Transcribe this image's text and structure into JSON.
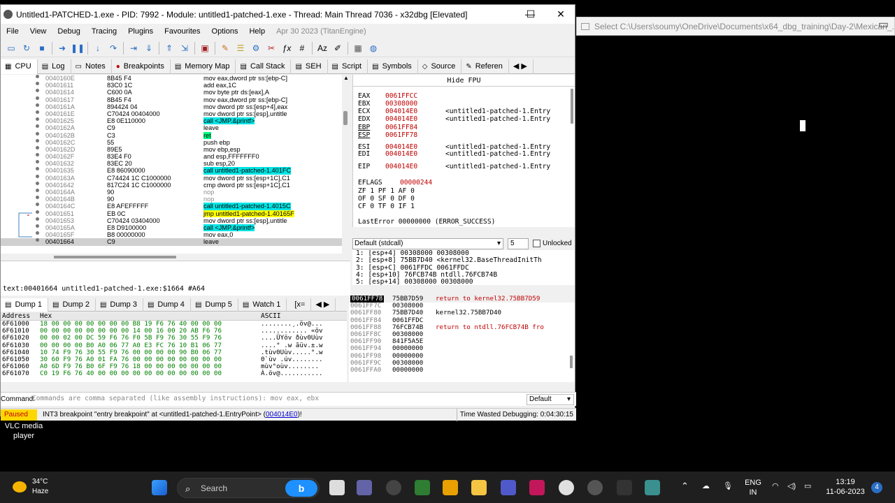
{
  "window": {
    "title": "Untitled1-PATCHED-1.exe - PID: 7992 - Module: untitled1-patched-1.exe - Thread: Main Thread 7036 - x32dbg [Elevated]",
    "min": "—",
    "max": "☐",
    "close": "✕"
  },
  "menu": [
    "File",
    "View",
    "Debug",
    "Tracing",
    "Plugins",
    "Favourites",
    "Options",
    "Help"
  ],
  "menu_version": "Apr 30 2023 (TitanEngine)",
  "tabs": [
    "CPU",
    "Log",
    "Notes",
    "Breakpoints",
    "Memory Map",
    "Call Stack",
    "SEH",
    "Script",
    "Symbols",
    "Source",
    "Referen"
  ],
  "disasm": [
    {
      "addr": "0040160E",
      "bytes": "8B45 F4",
      "ins": "mov eax,dword ptr ss:[ebp-C]"
    },
    {
      "addr": "00401611",
      "bytes": "83C0 1C",
      "ins": "add eax,1C"
    },
    {
      "addr": "00401614",
      "bytes": "C600 0A",
      "ins": "mov byte ptr ds:[eax],A"
    },
    {
      "addr": "00401617",
      "bytes": "8B45 F4",
      "ins": "mov eax,dword ptr ss:[ebp-C]"
    },
    {
      "addr": "0040161A",
      "bytes": "894424 04",
      "ins": "mov dword ptr ss:[esp+4],eax"
    },
    {
      "addr": "0040161E",
      "bytes": "C70424 00404000",
      "ins": "mov dword ptr ss:[esp],untitle"
    },
    {
      "addr": "00401625",
      "bytes": "E8 0E110000",
      "ins": "call <JMP.&printf>",
      "hl": "call"
    },
    {
      "addr": "0040162A",
      "bytes": "C9",
      "ins": "leave"
    },
    {
      "addr": "0040162B",
      "bytes": "C3",
      "ins": "ret",
      "hl": "ret"
    },
    {
      "addr": "0040162C",
      "bytes": "55",
      "ins": "push ebp"
    },
    {
      "addr": "0040162D",
      "bytes": "89E5",
      "ins": "mov ebp,esp"
    },
    {
      "addr": "0040162F",
      "bytes": "83E4 F0",
      "ins": "and esp,FFFFFFF0"
    },
    {
      "addr": "00401632",
      "bytes": "83EC 20",
      "ins": "sub esp,20"
    },
    {
      "addr": "00401635",
      "bytes": "E8 86090000",
      "ins": "call untitled1-patched-1.401FC",
      "hl": "call"
    },
    {
      "addr": "0040163A",
      "bytes": "C74424 1C C1000000",
      "ins": "mov dword ptr ss:[esp+1C],C1"
    },
    {
      "addr": "00401642",
      "bytes": "817C24 1C C1000000",
      "ins": "cmp dword ptr ss:[esp+1C],C1"
    },
    {
      "addr": "0040164A",
      "bytes": "90",
      "ins": "nop",
      "grey": true
    },
    {
      "addr": "0040164B",
      "bytes": "90",
      "ins": "nop",
      "grey": true
    },
    {
      "addr": "0040164C",
      "bytes": "E8 AFEFFFFF",
      "ins": "call untitled1-patched-1.4015C",
      "hl": "call"
    },
    {
      "addr": "00401651",
      "bytes": "EB 0C",
      "ins": "jmp untitled1-patched-1.40165F",
      "hl": "jmp"
    },
    {
      "addr": "00401653",
      "bytes": "C70424 03404000",
      "ins": "mov dword ptr ss:[esp],untitle"
    },
    {
      "addr": "0040165A",
      "bytes": "E8 D9100000",
      "ins": "call <JMP.&printf>",
      "hl": "call"
    },
    {
      "addr": "0040165F",
      "bytes": "B8 00000000",
      "ins": "mov eax,0"
    },
    {
      "addr": "00401664",
      "bytes": "C9",
      "ins": "leave",
      "sel": true
    }
  ],
  "info_line": "text:00401664 untitled1-patched-1.exe:$1664 #A64",
  "hide_fpu": "Hide FPU",
  "registers": [
    {
      "n": "EAX",
      "v": "0061FFCC",
      "c": ""
    },
    {
      "n": "EBX",
      "v": "00308000",
      "c": ""
    },
    {
      "n": "ECX",
      "v": "004014E0",
      "c": "<untitled1-patched-1.Entry"
    },
    {
      "n": "EDX",
      "v": "004014E0",
      "c": "<untitled1-patched-1.Entry"
    },
    {
      "n": "EBP",
      "v": "0061FF84",
      "c": ""
    },
    {
      "n": "ESP",
      "v": "0061FF78",
      "c": ""
    },
    {
      "n": "ESI",
      "v": "004014E0",
      "c": "<untitled1-patched-1.Entry"
    },
    {
      "n": "EDI",
      "v": "004014E0",
      "c": "<untitled1-patched-1.Entry"
    },
    {
      "n": "EIP",
      "v": "004014E0",
      "c": "<untitled1-patched-1.Entry"
    }
  ],
  "eflags": {
    "label": "EFLAGS",
    "value": "00000244"
  },
  "flags": [
    "ZF 1  PF 1  AF 0",
    "OF 0  SF 0  DF 0",
    "CF 0  TF 0  IF 1"
  ],
  "lasterror": "LastError  00000000 (ERROR_SUCCESS)",
  "callconv": {
    "selected": "Default (stdcall)",
    "count": "5",
    "unlocked": "Unlocked"
  },
  "args": [
    "1: [esp+4] 00308000 00308000",
    "2: [esp+8] 75BB7D40 <kernel32.BaseThreadInitTh",
    "3: [esp+C] 0061FFDC 0061FFDC",
    "4: [esp+10] 76FCB74B ntdll.76FCB74B",
    "5: [esp+14] 00308000 00308000"
  ],
  "dump_tabs": [
    "Dump 1",
    "Dump 2",
    "Dump 3",
    "Dump 4",
    "Dump 5",
    "Watch 1",
    "[x="
  ],
  "dump_headers": {
    "address": "Address",
    "hex": "Hex",
    "ascii": "ASCII"
  },
  "dump_rows": [
    {
      "a": "6F61000",
      "h": "18 00 00 00  00 00 00 00  B8 19 F6 76  40 00 00 00",
      "s": "........¸.öv@..."
    },
    {
      "a": "6F61010",
      "h": "00 00 00 00  00 00 00 00  14 00 16 00  20 AB F6 76",
      "s": "............ «öv"
    },
    {
      "a": "6F61020",
      "h": "00 00 02 00  DC 59 F6 76  F0 5B F9 76  30 55 F9 76",
      "s": "....ÜYöv ðùv0Uùv"
    },
    {
      "a": "6F61030",
      "h": "00 00 00 00  B0 A0 06 77  A0 E3 FC 76  10 B1 06 77",
      "s": "....° .w ãüv.±.w"
    },
    {
      "a": "6F61040",
      "h": "10 74 F9 76  30 55 F9 76  00 00 00 00  90 B0 06 77",
      "s": ".tùv0Uùv.....°.w"
    },
    {
      "a": "6F61050",
      "h": "30 60 F9 76  A0 01 FA 76  00 00 00 00  00 00 00 00",
      "s": "0`ùv .úv........"
    },
    {
      "a": "6F61060",
      "h": "A0 6D F9 76  B0 6F F9 76  18 00 00 00  00 00 00 00",
      "s": " mùv°oùv........"
    },
    {
      "a": "6F61070",
      "h": "C0 19 F6 76  40 00 00 00  00 00 00 00  00 00 00 00",
      "s": "À.öv@..........."
    }
  ],
  "stack": [
    {
      "a": "0061FF78",
      "v": "75BB7D59",
      "c": "return to kernel32.75BB7D59",
      "top": true,
      "ret": true
    },
    {
      "a": "0061FF7C",
      "v": "00308000",
      "c": ""
    },
    {
      "a": "0061FF80",
      "v": "75BB7D40",
      "c": "kernel32.75BB7D40"
    },
    {
      "a": "0061FF84",
      "v": "0061FFDC",
      "c": ""
    },
    {
      "a": "0061FF88",
      "v": "76FCB74B",
      "c": "return to ntdll.76FCB74B fro",
      "ret": true
    },
    {
      "a": "0061FF8C",
      "v": "00308000",
      "c": ""
    },
    {
      "a": "0061FF90",
      "v": "841F5A5E",
      "c": ""
    },
    {
      "a": "0061FF94",
      "v": "00000000",
      "c": ""
    },
    {
      "a": "0061FF98",
      "v": "00000000",
      "c": ""
    },
    {
      "a": "0061FF9C",
      "v": "00308000",
      "c": ""
    },
    {
      "a": "0061FFA0",
      "v": "00000000",
      "c": ""
    }
  ],
  "command": {
    "label": "Command:",
    "placeholder": "Commands are comma separated (like assembly instructions): mov eax, ebx",
    "mode": "Default"
  },
  "status": {
    "state": "Paused",
    "msg_pre": "INT3 breakpoint \"entry breakpoint\" at <untitled1-patched-1.EntryPoint> (",
    "msg_link": "004014E0",
    "msg_post": ")!",
    "wasted": "Time Wasted Debugging: 0:04:30:15"
  },
  "explorer_title": "Select C:\\Users\\soumy\\OneDrive\\Documents\\x64_dbg_training\\Day-2\\Mexican_...",
  "vlc_label": "VLC media player",
  "taskbar": {
    "temp": "34°C",
    "weather": "Haze",
    "search": "Search",
    "bing": "b",
    "lang1": "ENG",
    "lang2": "IN",
    "time": "13:19",
    "date": "11-06-2023",
    "badge": "4"
  },
  "colors": {
    "accent": "#2a6dc4",
    "paused": "#ffd700",
    "call_hl": "#00e5e5",
    "jmp_hl": "#ffff00",
    "reg_val": "#c00000"
  }
}
